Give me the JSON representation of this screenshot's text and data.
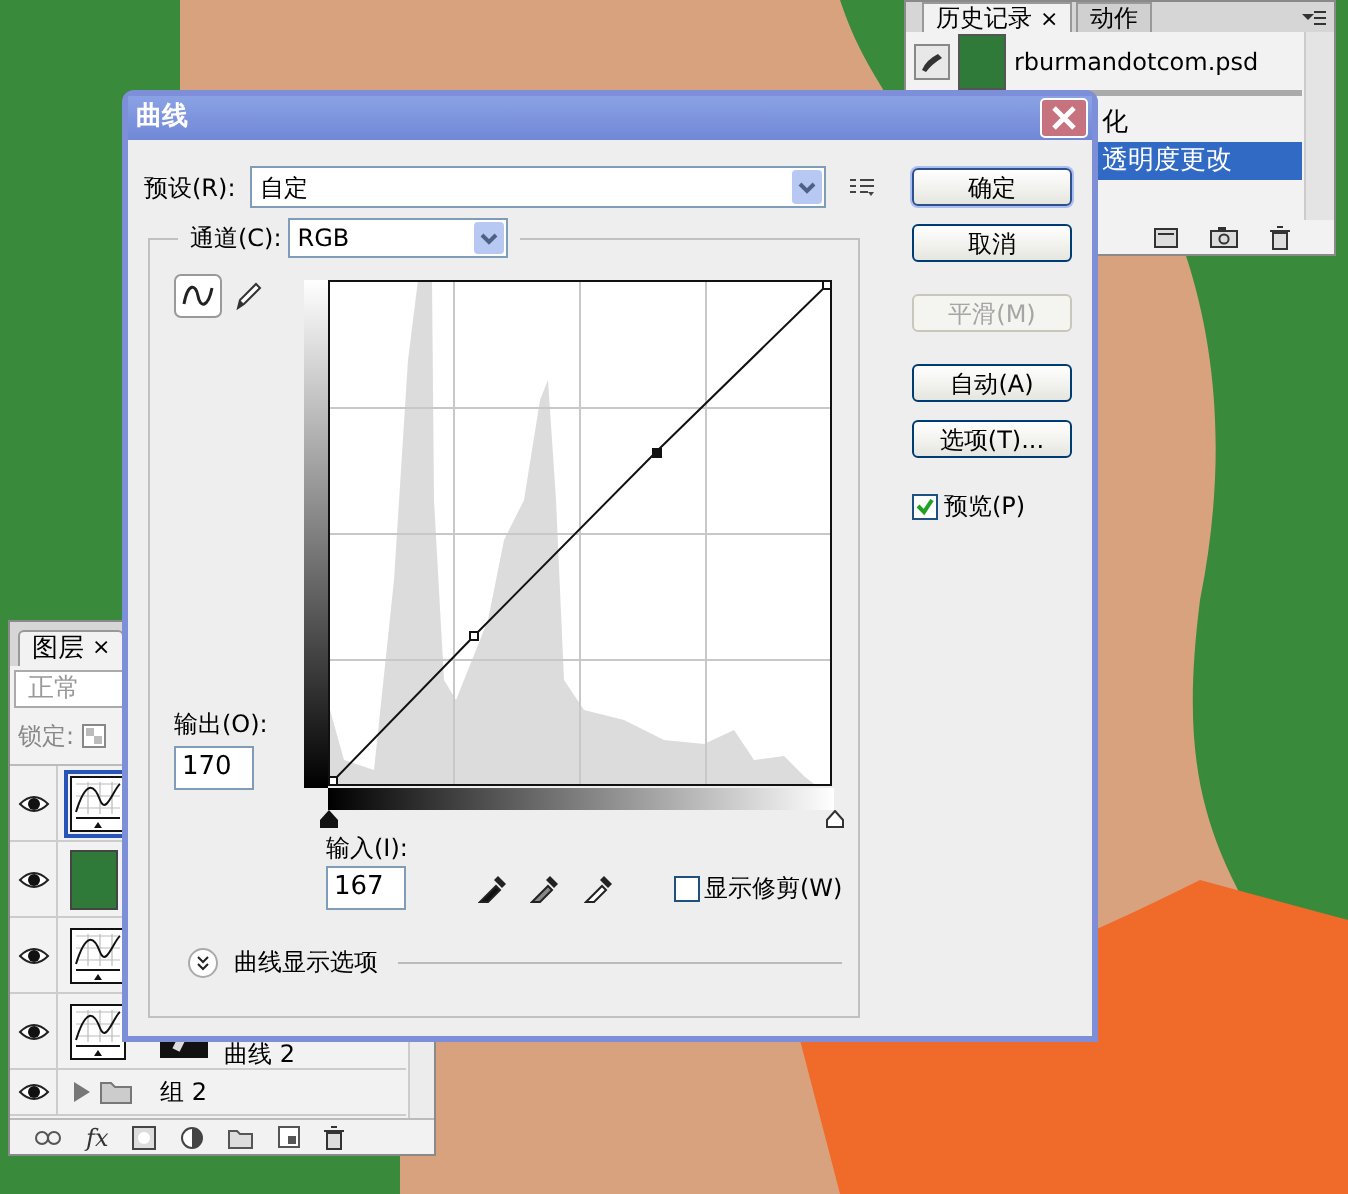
{
  "history_panel": {
    "tabs": [
      {
        "label": "历史记录",
        "selected": true,
        "close": "×"
      },
      {
        "label": "动作",
        "selected": false
      }
    ],
    "items": [
      {
        "kind": "snapshot",
        "label": "rburmandotcom.psd",
        "selected": false
      },
      {
        "kind": "step",
        "label": "化",
        "selected": false
      },
      {
        "kind": "step",
        "label": "透明度更改",
        "selected": true
      }
    ]
  },
  "layers_panel": {
    "tabs": [
      {
        "label": "图层",
        "selected": true,
        "close": "×"
      }
    ],
    "blend_mode": "正常",
    "lock_label": "锁定:",
    "fx_label": "fx",
    "layers": [
      {
        "kind": "adjustment",
        "visible": true,
        "selected": true
      },
      {
        "kind": "photo",
        "visible": true,
        "selected": false
      },
      {
        "kind": "adjustment",
        "visible": true,
        "selected": false
      },
      {
        "kind": "adjustment",
        "visible": true,
        "selected": false,
        "label": "曲线 2"
      },
      {
        "kind": "group",
        "visible": true,
        "selected": false,
        "label": "组 2"
      }
    ]
  },
  "curves_dialog": {
    "title": "曲线",
    "preset_label": "预设(R):",
    "preset": "自定",
    "channel_label": "通道(C):",
    "channel": "RGB",
    "input_sliders": [
      {
        "level": 0
      },
      {
        "level": 1
      }
    ],
    "output_label": "输出(O):",
    "output": "170",
    "input_label": "输入(I):",
    "input": "167",
    "show_clipping": {
      "label": "显示修剪(W)",
      "checked": false
    },
    "display_options": "曲线显示选项",
    "buttons": [
      {
        "label": "确定",
        "default": true,
        "disabled": false
      },
      {
        "label": "取消",
        "default": false,
        "disabled": false
      },
      {
        "label": "平滑(M)",
        "default": false,
        "disabled": true
      },
      {
        "label": "自动(A)",
        "default": false,
        "disabled": false
      },
      {
        "label": "选项(T)...",
        "default": false,
        "disabled": false
      }
    ],
    "preview": {
      "label": "预览(P)",
      "checked": true
    }
  }
}
